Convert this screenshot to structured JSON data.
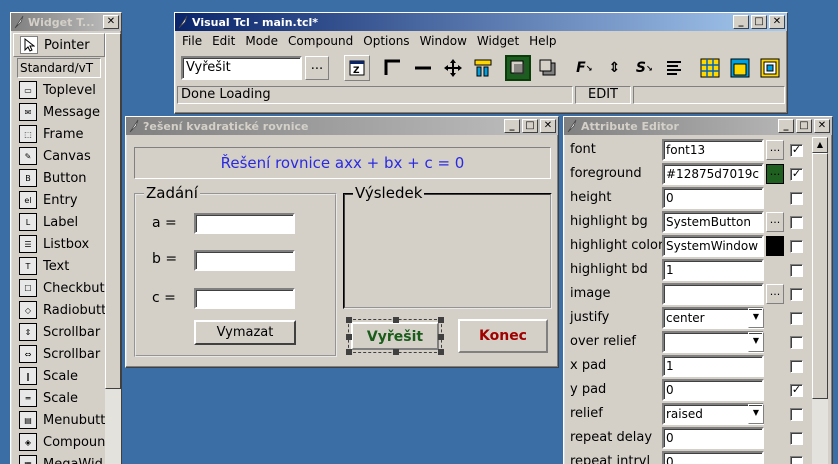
{
  "widget_toolbar": {
    "title": "Widget T...",
    "pointer": "Pointer",
    "section": "Standard/vT",
    "items": [
      "Toplevel",
      "Message",
      "Frame",
      "Canvas",
      "Button",
      "Entry",
      "Label",
      "Listbox",
      "Text",
      "Checkbut",
      "Radiobutt",
      "Scrollbar",
      "Scrollbar",
      "Scale",
      "Scale",
      "Menubutt",
      "Compound",
      "MegaWid"
    ]
  },
  "vtcl": {
    "title": "Visual Tcl - main.tcl*",
    "menu": [
      "File",
      "Edit",
      "Mode",
      "Compound",
      "Options",
      "Window",
      "Widget",
      "Help"
    ],
    "command_value": "Vyřešit",
    "command_button": "...",
    "status": "Done Loading",
    "mode": "EDIT"
  },
  "quad": {
    "title": "?ešení kvadratické rovnice",
    "heading": "Řešení rovnice axx + bx + c = 0",
    "input_frame": "Zadání",
    "a_label": "a =",
    "b_label": "b =",
    "c_label": "c =",
    "a_value": "",
    "b_value": "",
    "c_value": "",
    "clear_button": "Vymazat",
    "result_frame": "Výsledek",
    "solve_button": "Vyřešit",
    "quit_button": "Konec",
    "colors": {
      "heading": "#12875d",
      "solve": "#1a5c1a",
      "quit": "#8b0000",
      "heading_text": "#2a2ae0"
    }
  },
  "attr": {
    "title": "Attribute Editor",
    "rows": [
      {
        "label": "font",
        "value": "font13",
        "kind": "button",
        "checked": true
      },
      {
        "label": "foreground",
        "value": "#12875d7019c",
        "kind": "color-green",
        "checked": true
      },
      {
        "label": "height",
        "value": "0",
        "kind": "none",
        "checked": false
      },
      {
        "label": "highlight bg",
        "value": "SystemButton",
        "kind": "button",
        "checked": false
      },
      {
        "label": "highlight color",
        "value": "SystemWindow",
        "kind": "color-black",
        "checked": false
      },
      {
        "label": "highlight bd",
        "value": "1",
        "kind": "none",
        "checked": false
      },
      {
        "label": "image",
        "value": "",
        "kind": "button",
        "checked": false
      },
      {
        "label": "justify",
        "value": "center",
        "kind": "dropdown",
        "checked": false
      },
      {
        "label": "over relief",
        "value": "",
        "kind": "dropdown",
        "checked": false
      },
      {
        "label": "x pad",
        "value": "1",
        "kind": "none",
        "checked": false
      },
      {
        "label": "y pad",
        "value": "0",
        "kind": "none",
        "checked": true
      },
      {
        "label": "relief",
        "value": "raised",
        "kind": "dropdown",
        "checked": false
      },
      {
        "label": "repeat delay",
        "value": "0",
        "kind": "none",
        "checked": false
      },
      {
        "label": "repeat intrvl",
        "value": "0",
        "kind": "none",
        "checked": false
      }
    ]
  }
}
